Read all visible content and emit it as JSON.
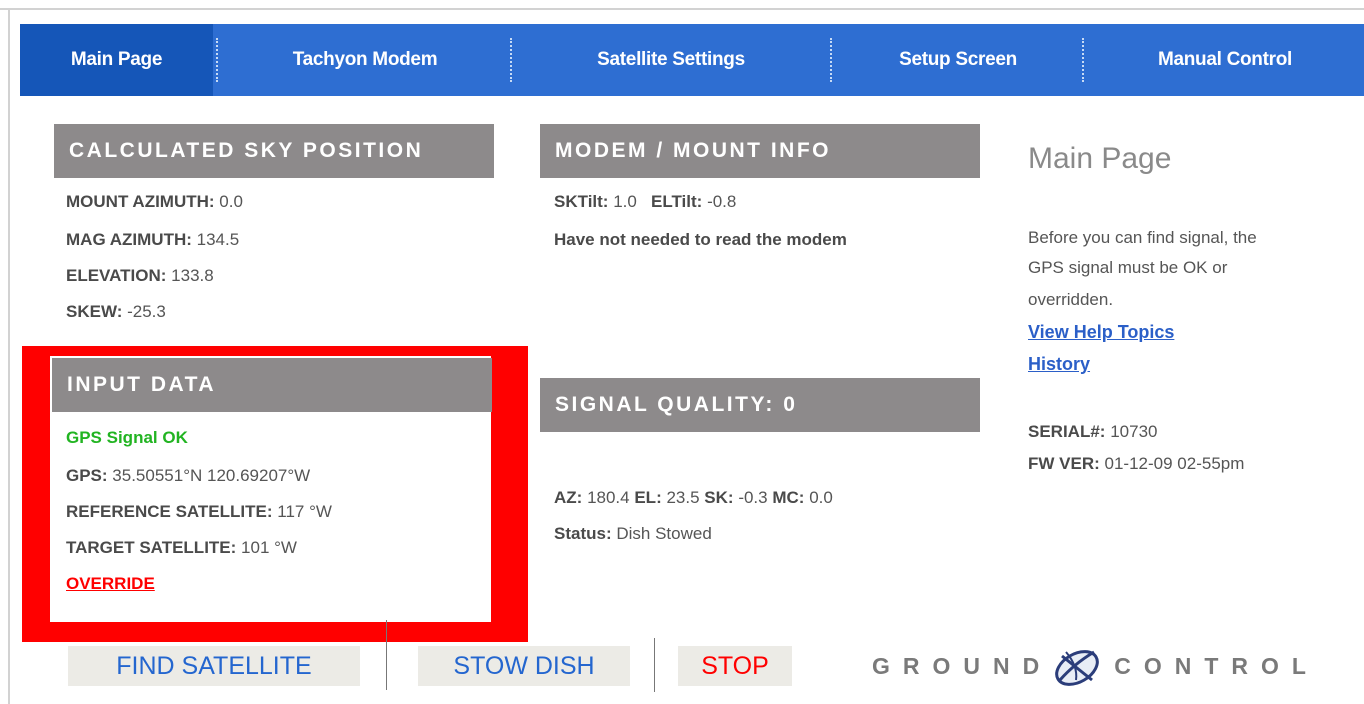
{
  "nav": {
    "items": [
      {
        "label": "Main Page",
        "active": true
      },
      {
        "label": "Tachyon Modem"
      },
      {
        "label": "Satellite Settings"
      },
      {
        "label": "Setup Screen"
      },
      {
        "label": "Manual Control"
      }
    ]
  },
  "sky_position": {
    "title": "CALCULATED SKY POSITION",
    "rows": [
      {
        "label": "MOUNT AZIMUTH:",
        "value": "0.0"
      },
      {
        "label": "MAG AZIMUTH:",
        "value": "134.5"
      },
      {
        "label": "ELEVATION:",
        "value": "133.8"
      },
      {
        "label": "SKEW:",
        "value": "-25.3"
      }
    ]
  },
  "modem_info": {
    "title": "MODEM / MOUNT INFO",
    "sktilt_label": "SKTilt:",
    "sktilt_value": "1.0",
    "eltilt_label": "ELTilt:",
    "eltilt_value": "-0.8",
    "message": "Have not needed to read the modem"
  },
  "input_data": {
    "title": "INPUT DATA",
    "gps_status": "GPS Signal OK",
    "gps_label": "GPS:",
    "gps_value": "35.50551°N 120.69207°W",
    "ref_sat_label": "REFERENCE SATELLITE:",
    "ref_sat_value": "117 °W",
    "target_sat_label": "TARGET SATELLITE:",
    "target_sat_value": "101 °W",
    "override_label": "OVERRIDE"
  },
  "signal_quality": {
    "title": "SIGNAL QUALITY: 0",
    "az_label": "AZ:",
    "az_value": "180.4",
    "el_label": "EL:",
    "el_value": "23.5",
    "sk_label": "SK:",
    "sk_value": "-0.3",
    "mc_label": "MC:",
    "mc_value": "0.0",
    "status_label": "Status:",
    "status_value": "Dish Stowed"
  },
  "side": {
    "title": "Main Page",
    "help_lines": [
      "Before you can find signal, the",
      "GPS signal must be OK or",
      "overridden."
    ],
    "help_link": "View Help Topics",
    "history_link": "History",
    "serial_label": "SERIAL#:",
    "serial_value": "10730",
    "fw_label": "FW VER:",
    "fw_value": "01-12-09 02-55pm"
  },
  "actions": {
    "find_satellite": "FIND SATELLITE",
    "stow_dish": "STOW DISH",
    "stop": "STOP"
  },
  "logo": {
    "left_text": "GROUND",
    "right_text": "CONTROL",
    "icon": "satellite-dish-icon"
  },
  "colors": {
    "nav_bg": "#2e6ed2",
    "nav_active": "#1556b8",
    "header_bg": "#8d8a8b",
    "highlight_box": "#ff0000",
    "ok_green": "#22b422",
    "link_blue": "#2b5fc8"
  }
}
